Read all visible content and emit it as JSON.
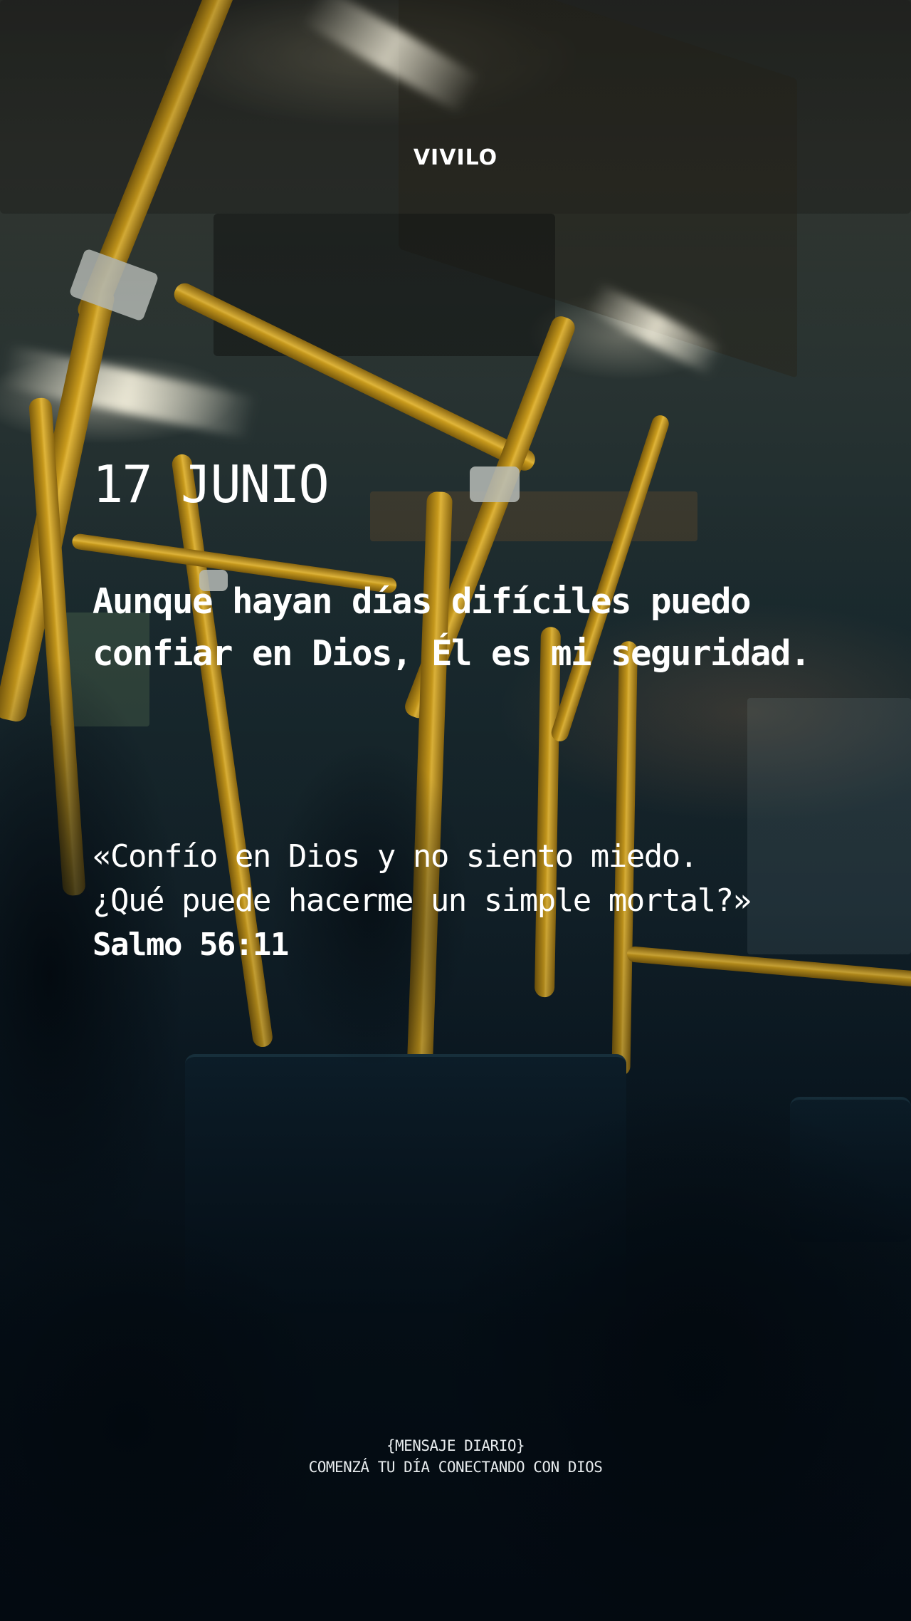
{
  "brand": {
    "logo_text": "VIVILO"
  },
  "date": "17 JUNIO",
  "headline": "Aunque hayan días difíciles puedo confiar en Dios, Él es mi seguridad.",
  "verse": {
    "lines": [
      "«Confío en Dios y no siento miedo.",
      "¿Qué puede hacerme un simple mortal?»"
    ],
    "reference": "Salmo 56:11"
  },
  "footer": {
    "label": "{MENSAJE DIARIO}",
    "tagline": "COMENZÁ TU DÍA CONECTANDO CON DIOS"
  },
  "colors": {
    "text": "#ffffff",
    "pole_yellow": "#d4a21f",
    "background_dark": "#06121c"
  }
}
